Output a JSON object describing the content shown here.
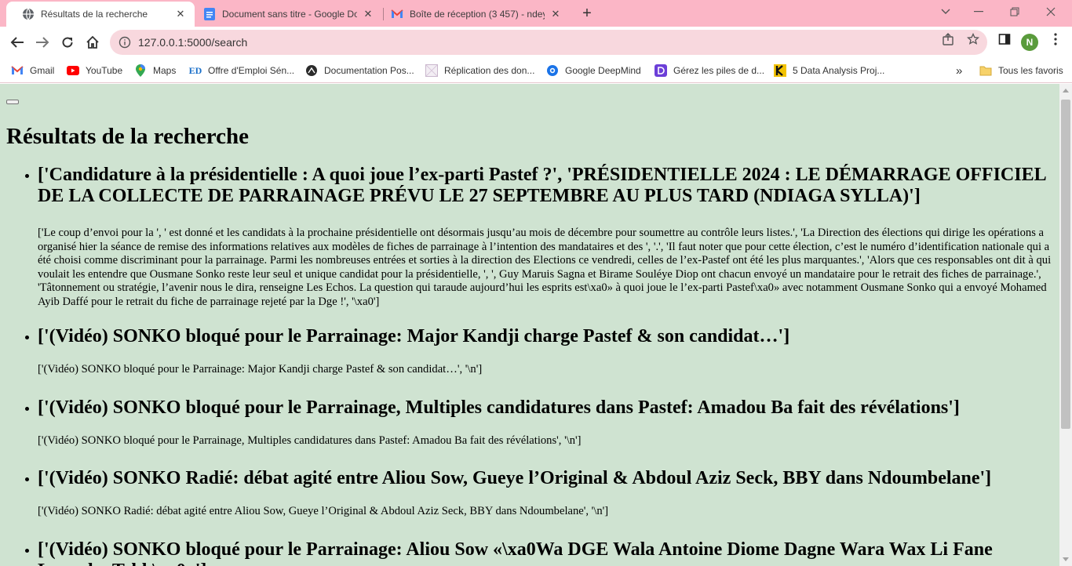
{
  "browser": {
    "tabs": [
      {
        "title": "Résultats de la recherche",
        "icon": "globe-icon",
        "active": true
      },
      {
        "title": "Document sans titre - Google Docs",
        "icon": "google-docs-icon",
        "active": false
      },
      {
        "title": "Boîte de réception (3 457) - ndey",
        "icon": "gmail-icon",
        "active": false
      }
    ],
    "new_tab": "+",
    "url": "127.0.0.1:5000/search",
    "profile_initial": "N",
    "accent": "#fbb6c6",
    "bookmarks": [
      {
        "label": "Gmail",
        "icon": "gmail-icon"
      },
      {
        "label": "YouTube",
        "icon": "youtube-icon"
      },
      {
        "label": "Maps",
        "icon": "maps-pin-icon"
      },
      {
        "label": "Offre d'Emploi Sén...",
        "icon": "ed-logo-icon"
      },
      {
        "label": "Documentation Pos...",
        "icon": "postman-icon"
      },
      {
        "label": "Réplication des don...",
        "icon": "placeholder-image-icon"
      },
      {
        "label": "Google DeepMind",
        "icon": "deepmind-icon"
      },
      {
        "label": "Gérez les piles de d...",
        "icon": "purple-d-icon"
      },
      {
        "label": "5 Data Analysis Proj...",
        "icon": "k-logo-icon"
      }
    ],
    "overflow": "»",
    "all_bookmarks": "Tous les favoris"
  },
  "page": {
    "background": "#cfe3d1",
    "title": "Résultats de la recherche",
    "results": [
      {
        "title": "['Candidature à la présidentielle : A quoi joue l’ex-parti Pastef ?', 'PRÉSIDENTIELLE 2024 : LE DÉMARRAGE OFFICIEL DE LA COLLECTE DE PARRAINAGE PRÉVU LE 27 SEPTEMBRE AU PLUS TARD (NDIAGA SYLLA)']",
        "summary": "['Le coup d’envoi pour la ', ' est donné et les candidats à la prochaine présidentielle ont désormais jusqu’au mois de décembre pour soumettre au contrôle leurs listes.', 'La Direction des élections qui dirige les opérations a organisé hier la séance de remise des informations relatives aux modèles de fiches de parrainage à l’intention des mandataires et des ', '.', 'Il faut noter que pour cette élection, c’est le numéro d’identification nationale qui a été choisi comme discriminant pour la parrainage. Parmi les nombreuses entrées et sorties à la direction des Elections ce vendredi, celles de l’ex-Pastef ont été les plus marquantes.', 'Alors que ces responsables ont dit à qui voulait les entendre que Ousmane Sonko reste leur seul et unique candidat pour la présidentielle, ', ', Guy Maruis Sagna et Birame Souléye Diop ont chacun envoyé un mandataire pour le retrait des fiches de parrainage.', 'Tâtonnement ou stratégie, l’avenir nous le dira, renseigne Les Echos. La question qui taraude aujourd’hui les esprits est\\xa0» à quoi joue le l’ex-parti Pastef\\xa0» avec notamment Ousmane Sonko qui a envoyé Mohamed Ayib Daffé pour le retrait du fiche de parrainage rejeté par la Dge !', '\\xa0']"
      },
      {
        "title": "['(Vidéo) SONKO bloqué pour le Parrainage: Major Kandji charge Pastef & son candidat…']",
        "summary": "['(Vidéo) SONKO bloqué pour le Parrainage: Major Kandji charge Pastef & son candidat…', '\\n']"
      },
      {
        "title": "['(Vidéo) SONKO bloqué pour le Parrainage, Multiples candidatures dans Pastef: Amadou Ba fait des révélations']",
        "summary": "['(Vidéo) SONKO bloqué pour le Parrainage, Multiples candidatures dans Pastef: Amadou Ba fait des révélations', '\\n']"
      },
      {
        "title": "['(Vidéo) SONKO Radié: débat agité entre Aliou Sow, Gueye l’Original & Abdoul Aziz Seck, BBY dans Ndoumbelane']",
        "summary": "['(Vidéo) SONKO Radié: débat agité entre Aliou Sow, Gueye l’Original & Abdoul Aziz Seck, BBY dans Ndoumbelane', '\\n']"
      },
      {
        "title": "['(Vidéo) SONKO bloqué pour le Parrainage: Aliou Sow «\\xa0Wa DGE Wala Antoine Diome Dagne Wara Wax Li Fane Lagneko Tekk\\xa0»']",
        "summary": ""
      }
    ]
  }
}
